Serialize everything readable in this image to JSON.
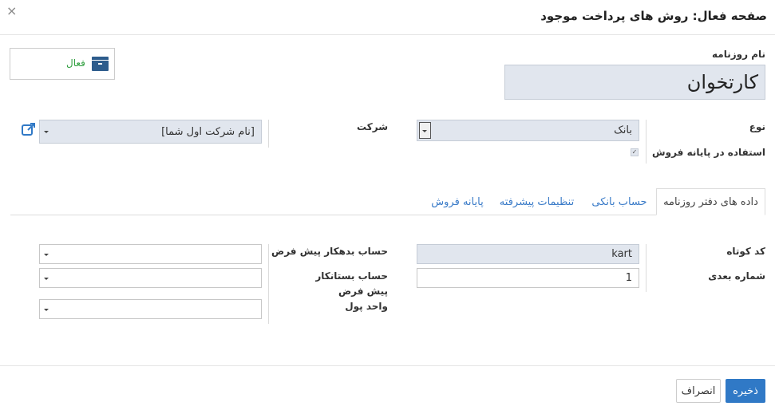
{
  "header": {
    "title": "صفحه فعال: روش های پرداخت موجود",
    "close": "×"
  },
  "status_button": {
    "label": "فعال"
  },
  "journal_name": {
    "label": "نام روزنامه",
    "value": "کارتخوان"
  },
  "fields": {
    "type_label": "نوع",
    "type_value": "بانک",
    "pos_label": "استفاده در پایانه فروش",
    "pos_checked": "✓",
    "company_label": "شرکت",
    "company_value": "[نام شرکت اول شما]"
  },
  "tabs": [
    {
      "label": "داده های دفتر روزنامه",
      "active": true
    },
    {
      "label": "حساب بانکی",
      "active": false
    },
    {
      "label": "تنظیمات پیشرفته",
      "active": false
    },
    {
      "label": "پایانه فروش",
      "active": false
    }
  ],
  "journal_tab": {
    "short_code_label": "کد کوتاه",
    "short_code_value": "kart",
    "next_number_label": "شماره بعدی",
    "next_number_value": "1",
    "default_debit_label": "حساب بدهکار پیش فرض",
    "default_credit_label": "حساب بستانکار پیش فرض",
    "currency_label": "واحد پول"
  },
  "footer": {
    "save_label": "ذخیره",
    "cancel_label": "انصراف"
  },
  "colors": {
    "primary": "#3079c6",
    "status_green": "#2e9e3e",
    "link_blue": "#3a7bc8",
    "readonly_bg": "#e1e6ee"
  }
}
